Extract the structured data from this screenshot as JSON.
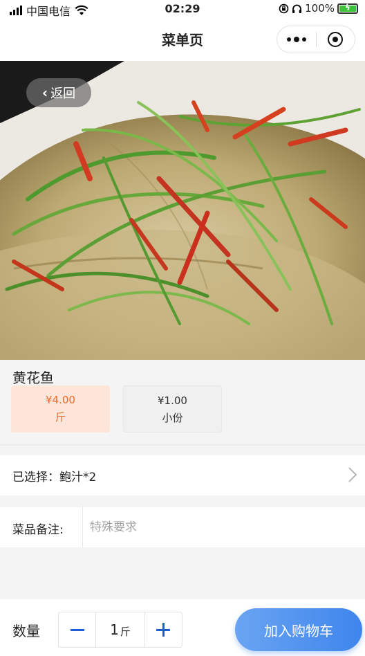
{
  "status_bar": {
    "carrier": "中国电信",
    "time": "02:29",
    "battery": "100%"
  },
  "nav": {
    "title": "菜单页"
  },
  "back_button": {
    "label": "返回"
  },
  "dish": {
    "name": "黄花鱼",
    "specs": [
      {
        "price": "¥4.00",
        "unit": "斤",
        "selected": true
      },
      {
        "price": "¥1.00",
        "unit": "小份",
        "selected": false
      }
    ]
  },
  "options": {
    "selected_text": "已选择：鲍汁*2"
  },
  "note": {
    "label": "菜品备注:",
    "placeholder": "特殊要求",
    "value": ""
  },
  "quantity": {
    "label": "数量",
    "value": "1",
    "unit": "斤"
  },
  "actions": {
    "add_to_cart": "加入购物车"
  },
  "colors": {
    "accent_blue": "#3e85ec",
    "selected_spec_bg": "#fde5da",
    "selected_spec_text": "#f06a2c"
  }
}
